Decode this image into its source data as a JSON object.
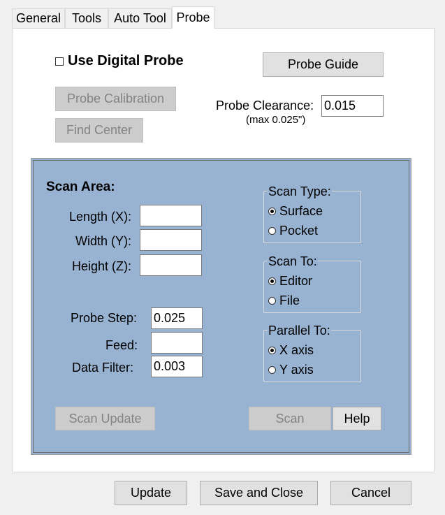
{
  "tabs": [
    {
      "label": "General"
    },
    {
      "label": "Tools"
    },
    {
      "label": "Auto Tool"
    },
    {
      "label": "Probe",
      "active": true
    }
  ],
  "probe": {
    "use_digital_probe_label": "Use Digital Probe",
    "use_digital_probe_checked": false,
    "probe_guide_button": "Probe Guide",
    "probe_calibration_button": "Probe Calibration",
    "find_center_button": "Find Center",
    "clearance_label": "Probe Clearance:",
    "clearance_value": "0.015",
    "clearance_hint": "(max 0.025\")"
  },
  "scan": {
    "title": "Scan Area:",
    "length_label": "Length (X):",
    "length_value": "",
    "width_label": "Width (Y):",
    "width_value": "",
    "height_label": "Height (Z):",
    "height_value": "",
    "probe_step_label": "Probe Step:",
    "probe_step_value": "0.025",
    "feed_label": "Feed:",
    "feed_value": "",
    "data_filter_label": "Data Filter:",
    "data_filter_value": "0.003",
    "scan_type": {
      "title": "Scan Type:",
      "options": [
        "Surface",
        "Pocket"
      ],
      "selected": "Surface"
    },
    "scan_to": {
      "title": "Scan To:",
      "options": [
        "Editor",
        "File"
      ],
      "selected": "Editor"
    },
    "parallel_to": {
      "title": "Parallel To:",
      "options": [
        "X axis",
        "Y axis"
      ],
      "selected": "X axis"
    },
    "scan_update_button": "Scan Update",
    "scan_button": "Scan",
    "help_button": "Help"
  },
  "footer": {
    "update_button": "Update",
    "save_close_button": "Save and Close",
    "cancel_button": "Cancel"
  },
  "colors": {
    "scan_area_bg": "#98b2d1",
    "disabled_button_bg": "#cccccc",
    "button_bg": "#e1e1e1"
  }
}
